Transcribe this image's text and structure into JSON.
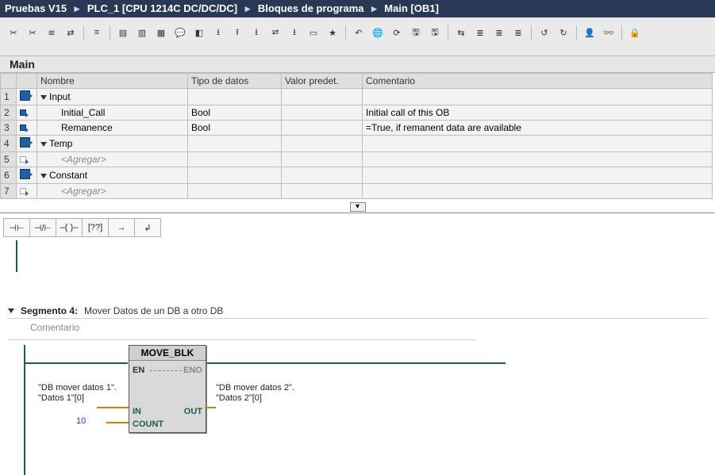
{
  "breadcrumb": {
    "project": "Pruebas V15",
    "device": "PLC_1 [CPU 1214C DC/DC/DC]",
    "group": "Bloques de programa",
    "block": "Main [OB1]"
  },
  "block_title": "Main",
  "columns": {
    "name": "Nombre",
    "type": "Tipo de datos",
    "default": "Valor predet.",
    "comment": "Comentario"
  },
  "rows": [
    {
      "n": "1",
      "kind": "section",
      "name": "Input"
    },
    {
      "n": "2",
      "kind": "var",
      "name": "Initial_Call",
      "type": "Bool",
      "comment": "Initial call of this OB"
    },
    {
      "n": "3",
      "kind": "var",
      "name": "Remanence",
      "type": "Bool",
      "comment": "=True, if remanent data are available"
    },
    {
      "n": "4",
      "kind": "section",
      "name": "Temp"
    },
    {
      "n": "5",
      "kind": "add",
      "name": "<Agregar>"
    },
    {
      "n": "6",
      "kind": "section",
      "name": "Constant"
    },
    {
      "n": "7",
      "kind": "add",
      "name": "<Agregar>"
    }
  ],
  "palette": [
    "⊣⊢",
    "⊣/⊢",
    "–( )–",
    "[??]",
    "→",
    "↲"
  ],
  "segment": {
    "title": "Segmento 4:",
    "subtitle": "Mover Datos de un DB a otro DB",
    "comment": "Comentario"
  },
  "block": {
    "title": "MOVE_BLK",
    "en": "EN",
    "eno": "ENO",
    "in": "IN",
    "out": "OUT",
    "count": "COUNT",
    "in_op_a": "\"DB mover datos 1\".",
    "in_op_b": "\"Datos 1\"[0]",
    "count_val": "10",
    "out_op_a": "\"DB mover datos 2\".",
    "out_op_b": "\"Datos 2\"[0]"
  },
  "toolbar_icons": [
    "t1",
    "t2",
    "t3",
    "t4",
    "sep",
    "t5",
    "sep",
    "t6",
    "t7",
    "t8",
    "t9",
    "t10",
    "t11",
    "t12",
    "t13",
    "t14",
    "t15",
    "t16",
    "t17",
    "sep",
    "t18",
    "t19",
    "t20",
    "t21",
    "t22",
    "sep",
    "t23",
    "t24",
    "t25",
    "t26",
    "sep",
    "t27",
    "t28",
    "sep",
    "t29",
    "t30",
    "sep",
    "t31"
  ]
}
